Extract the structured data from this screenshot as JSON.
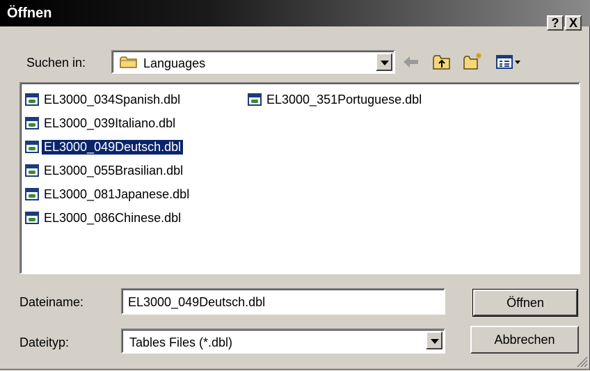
{
  "window": {
    "title": "Öffnen",
    "help_label": "?",
    "close_label": "X"
  },
  "look_in": {
    "label": "Suchen in:",
    "value": "Languages"
  },
  "toolbar": {
    "icons": [
      "back-arrow-icon",
      "up-folder-icon",
      "new-folder-icon",
      "view-menu-icon"
    ]
  },
  "files": [
    {
      "name": "EL3000_034Spanish.dbl",
      "selected": false
    },
    {
      "name": "EL3000_039Italiano.dbl",
      "selected": false
    },
    {
      "name": "EL3000_049Deutsch.dbl",
      "selected": true
    },
    {
      "name": "EL3000_055Brasilian.dbl",
      "selected": false
    },
    {
      "name": "EL3000_081Japanese.dbl",
      "selected": false
    },
    {
      "name": "EL3000_086Chinese.dbl",
      "selected": false
    },
    {
      "name": "EL3000_351Portuguese.dbl",
      "selected": false
    }
  ],
  "filename": {
    "label": "Dateiname:",
    "value": "EL3000_049Deutsch.dbl"
  },
  "filetype": {
    "label": "Dateityp:",
    "value": "Tables Files (*.dbl)"
  },
  "buttons": {
    "open": "Öffnen",
    "cancel": "Abbrechen"
  }
}
